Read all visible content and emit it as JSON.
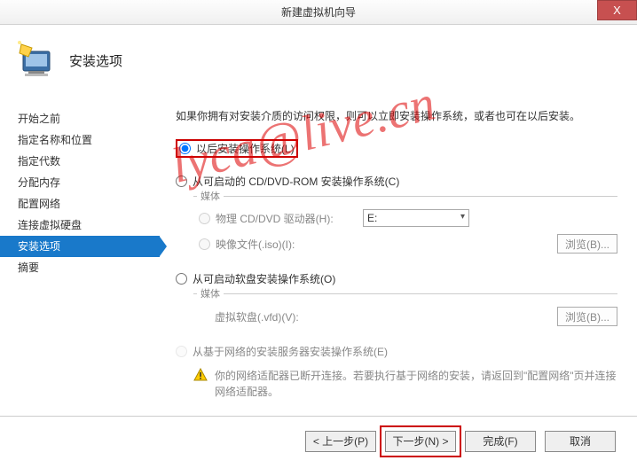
{
  "titlebar": {
    "title": "新建虚拟机向导",
    "close": "X"
  },
  "header": {
    "title": "安装选项"
  },
  "sidebar": {
    "items": [
      {
        "label": "开始之前"
      },
      {
        "label": "指定名称和位置"
      },
      {
        "label": "指定代数"
      },
      {
        "label": "分配内存"
      },
      {
        "label": "配置网络"
      },
      {
        "label": "连接虚拟硬盘"
      },
      {
        "label": "安装选项"
      },
      {
        "label": "摘要"
      }
    ]
  },
  "main": {
    "desc": "如果你拥有对安装介质的访问权限，则可以立即安装操作系统，或者也可在以后安装。",
    "opt_later": "以后安装操作系统(L)",
    "opt_cd": "从可启动的 CD/DVD-ROM 安装操作系统(C)",
    "opt_floppy": "从可启动软盘安装操作系统(O)",
    "opt_net": "从基于网络的安装服务器安装操作系统(E)",
    "media_label": "媒体",
    "phys_cd_label": "物理 CD/DVD 驱动器(H):",
    "drive_value": "E:",
    "iso_label": "映像文件(.iso)(I):",
    "vfd_label": "虚拟软盘(.vfd)(V):",
    "browse": "浏览(B)...",
    "warn": "你的网络适配器已断开连接。若要执行基于网络的安装，请返回到\"配置网络\"页并连接网络适配器。"
  },
  "footer": {
    "back": "< 上一步(P)",
    "next": "下一步(N) >",
    "finish": "完成(F)",
    "cancel": "取消"
  },
  "watermark": "lyca@live.cn"
}
